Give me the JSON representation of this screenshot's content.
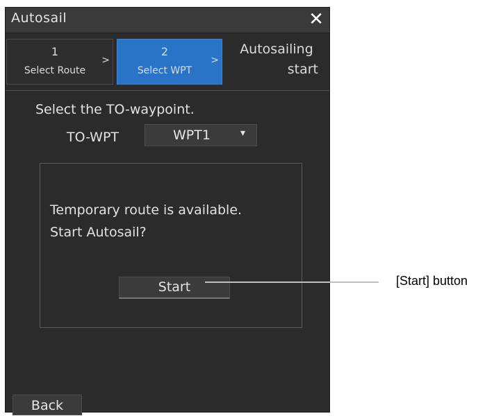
{
  "window": {
    "title": "Autosail",
    "close_icon": "close-icon"
  },
  "steps": [
    {
      "number": "1",
      "label": "Select Route",
      "arrow": ">"
    },
    {
      "number": "2",
      "label": "Select WPT",
      "arrow": ">"
    },
    {
      "line1": "Autosailing",
      "line2": "start"
    }
  ],
  "prompt": "Select the TO-waypoint.",
  "to_wpt": {
    "label": "TO-WPT",
    "value": "WPT1",
    "arrow": "▾"
  },
  "message": {
    "line1": "Temporary route is available.",
    "line2": "Start Autosail?"
  },
  "buttons": {
    "start": "Start",
    "back": "Back"
  },
  "callout": {
    "text": "[Start] button"
  },
  "colors": {
    "panel": "#2b2b2b",
    "active_step": "#2a74c8"
  }
}
